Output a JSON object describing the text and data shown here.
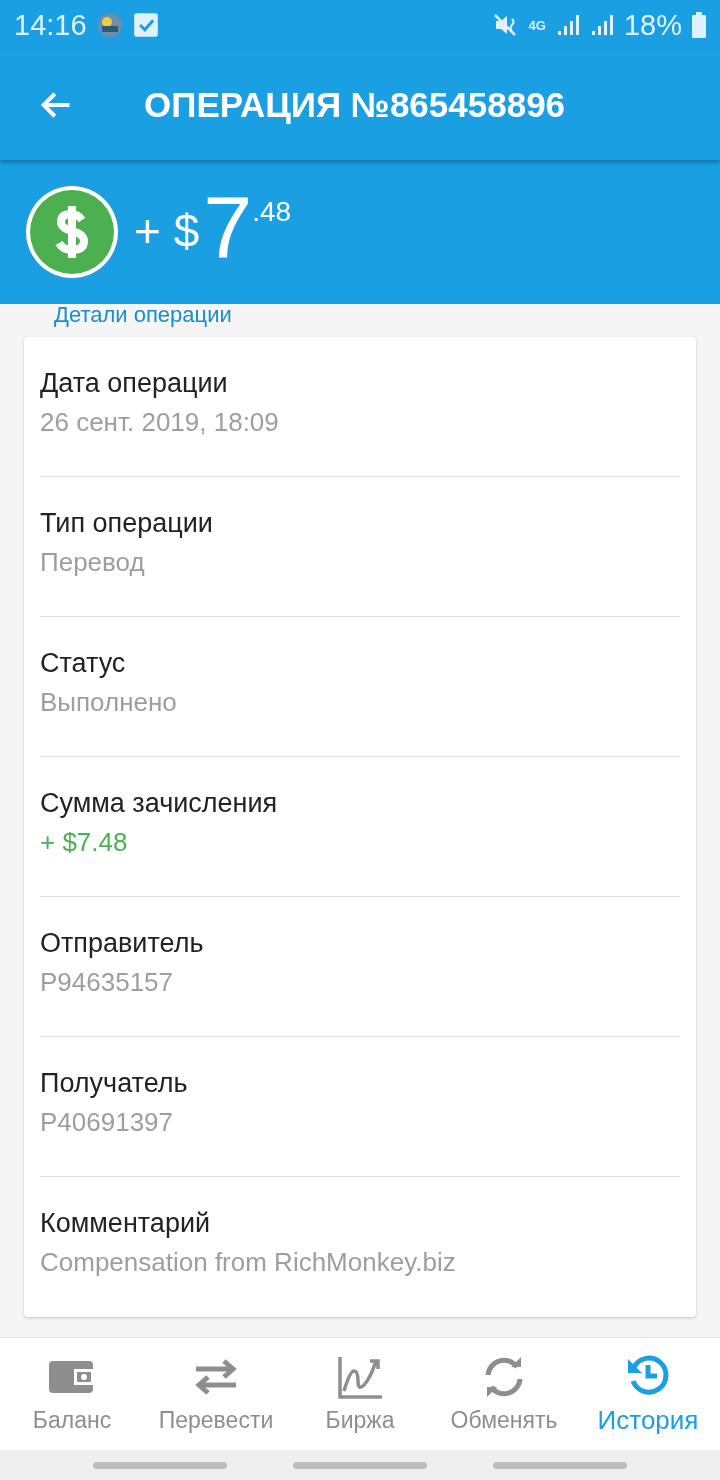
{
  "status_bar": {
    "time": "14:16",
    "network": "4G",
    "battery": "18%"
  },
  "toolbar": {
    "title": "ОПЕРАЦИЯ №865458896"
  },
  "amount": {
    "prefix": "+ $",
    "whole": "7",
    "fraction": ".48"
  },
  "section_label": "Детали операции",
  "fields": [
    {
      "label": "Дата операции",
      "value": "26 сент. 2019, 18:09",
      "kind": "plain"
    },
    {
      "label": "Тип операции",
      "value": "Перевод",
      "kind": "plain"
    },
    {
      "label": "Статус",
      "value": "Выполнено",
      "kind": "plain"
    },
    {
      "label": "Сумма зачисления",
      "value": "+ $7.48",
      "kind": "credit"
    },
    {
      "label": "Отправитель",
      "value": "P94635157",
      "kind": "plain"
    },
    {
      "label": "Получатель",
      "value": "P40691397",
      "kind": "plain"
    },
    {
      "label": "Комментарий",
      "value": "Compensation from RichMonkey.biz",
      "kind": "plain"
    }
  ],
  "bottom_nav": [
    {
      "label": "Баланс",
      "selected": false
    },
    {
      "label": "Перевести",
      "selected": false
    },
    {
      "label": "Биржа",
      "selected": false
    },
    {
      "label": "Обменять",
      "selected": false
    },
    {
      "label": "История",
      "selected": true
    }
  ]
}
